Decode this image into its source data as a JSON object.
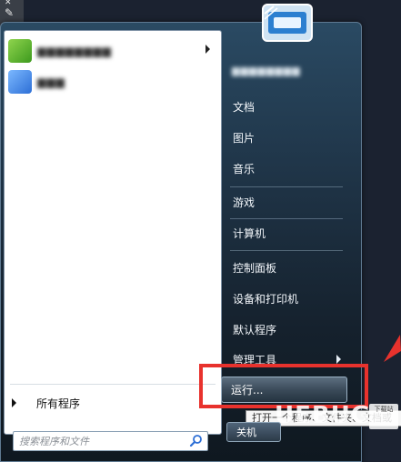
{
  "start_menu": {
    "pinned_programs": [
      {
        "label": "▆▆▆▆▆▆▆▆",
        "icon": "program-green-icon",
        "has_submenu": true
      },
      {
        "label": "▆▆▆",
        "icon": "program-blue-icon",
        "has_submenu": false
      }
    ],
    "all_programs_label": "所有程序",
    "search": {
      "placeholder": "搜索程序和文件",
      "value": ""
    },
    "user_name": "▆▆▆▆▆▆▆▆",
    "right_items": [
      {
        "label": "文档"
      },
      {
        "label": "图片"
      },
      {
        "label": "音乐"
      },
      {
        "label": "游戏"
      },
      {
        "label": "计算机"
      },
      {
        "label": "控制面板"
      },
      {
        "label": "设备和打印机"
      },
      {
        "label": "默认程序"
      },
      {
        "label": "管理工具",
        "has_submenu": true
      }
    ],
    "run_label": "运行...",
    "run_tooltip": "打开一个程序、文件夹、文档或",
    "shutdown_label": "关机"
  },
  "watermark": {
    "text": "UEBUG",
    "badge": "下载站"
  },
  "colors": {
    "highlight": "#e8322d",
    "accent": "#1f3447"
  }
}
